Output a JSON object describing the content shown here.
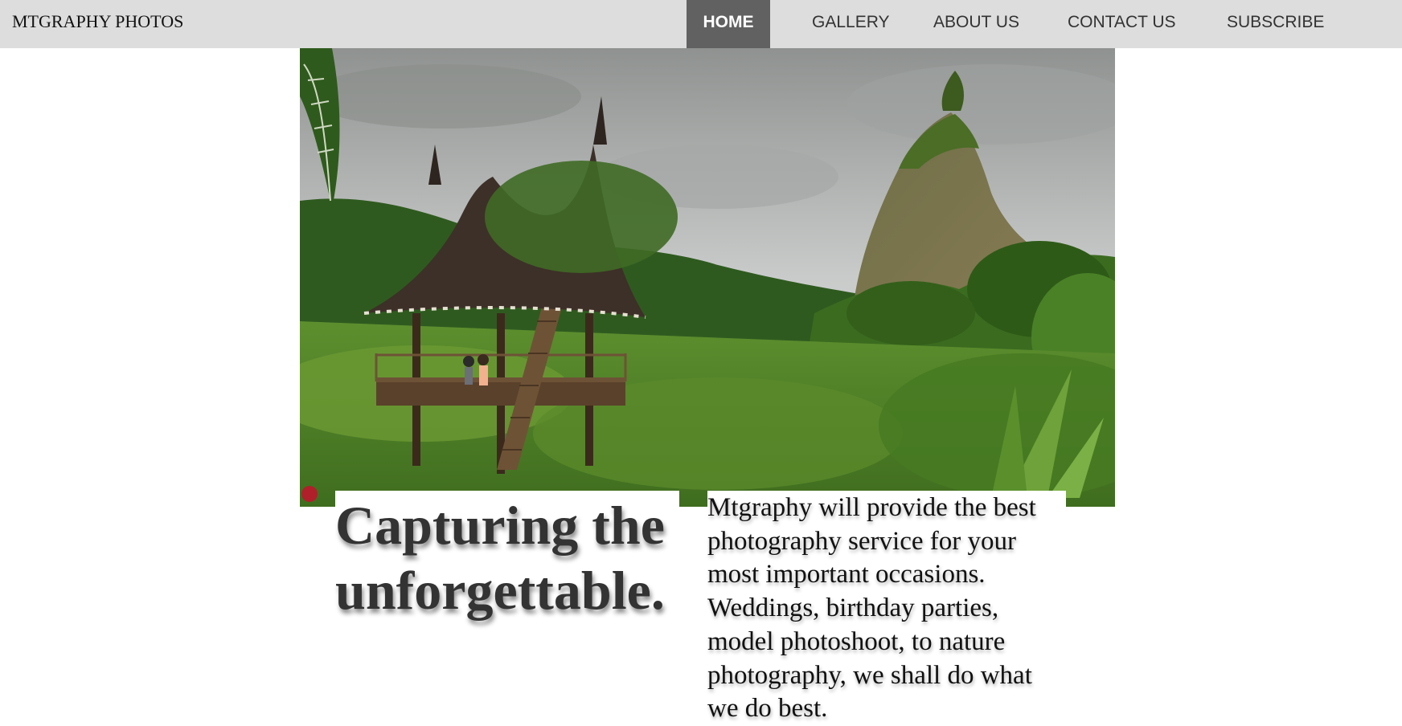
{
  "header": {
    "brand": "MTGRAPHY PHOTOS",
    "nav": {
      "home": "HOME",
      "gallery": "GALLERY",
      "about": "ABOUT US",
      "contact": "CONTACT US",
      "subscribe": "SUBSCRIBE"
    },
    "active_item": "HOME"
  },
  "hero": {
    "image_subject": "landscape photo: traditional pavilion with curved roof amid lush jungle and a steep green peak under cloudy sky"
  },
  "main": {
    "headline": "Capturing the unforgettable.",
    "description": "Mtgraphy will provide the best photography service for your most important occasions. Weddings, birthday parties, model photoshoot, to nature photography, we shall do what we do best."
  },
  "colors": {
    "navbar_bg": "#dddddd",
    "active_nav_bg": "#616161",
    "active_nav_text": "#ffffff",
    "nav_text": "#333333",
    "headline_text": "#333333"
  }
}
